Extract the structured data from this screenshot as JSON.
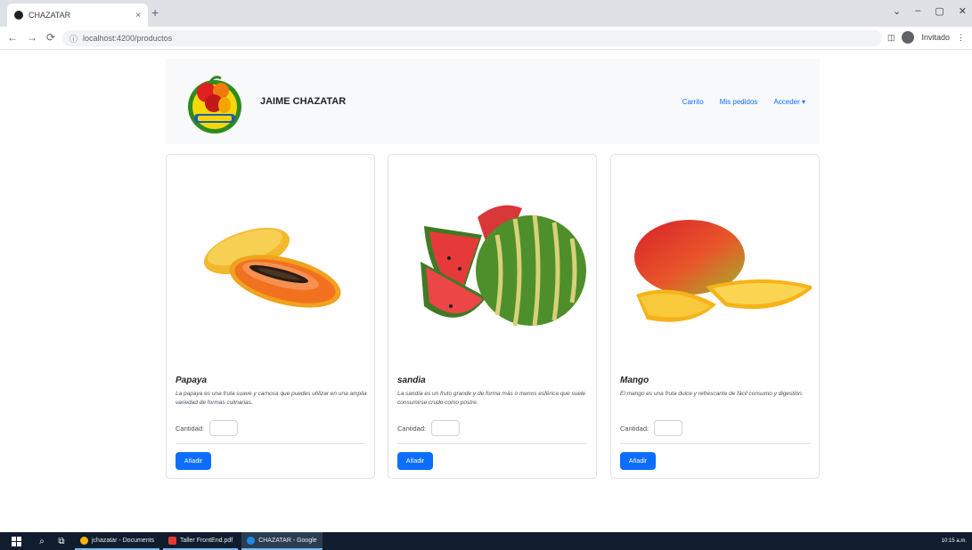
{
  "browser": {
    "tab_title": "CHAZATAR",
    "tab_close": "×",
    "new_tab": "+",
    "window_controls": [
      "⌄",
      "–",
      "▢",
      "✕"
    ],
    "nav": [
      "←",
      "→",
      "⟳"
    ],
    "url": "localhost:4200/productos",
    "profile_label": "Invitado",
    "menu": "⋮"
  },
  "header": {
    "brand": "JAIME CHAZATAR",
    "nav": [
      "Carrito",
      "Mis pedidos",
      "Acceder ▾"
    ]
  },
  "products": [
    {
      "name": "Papaya",
      "description": "La papaya es una fruta suave y carnosa que puedes utilizar en una amplia variedad de formas culinarias.",
      "qty_label": "Cantidad:",
      "button": "Añadir"
    },
    {
      "name": "sandia",
      "description": "La sandía es un fruto grande y de forma más o menos esférica que suele consumirse crudo como postre.",
      "qty_label": "Cantidad:",
      "button": "Añadir"
    },
    {
      "name": "Mango",
      "description": "El mango es una fruta dulce y refrescante de fácil consumo y digestión.",
      "qty_label": "Cantidad:",
      "button": "Añadir"
    }
  ],
  "taskbar": {
    "search": "⌕",
    "taskview": "⧉",
    "apps": [
      "jchazatar - Documents",
      "Taller FrontEnd.pdf",
      "CHAZATAR - Google"
    ],
    "clock": "10:15 a.m."
  },
  "colors": {
    "primary": "#0d6efd",
    "header_bg": "#f8f9fa",
    "taskbar_bg": "#0f1d2e"
  }
}
